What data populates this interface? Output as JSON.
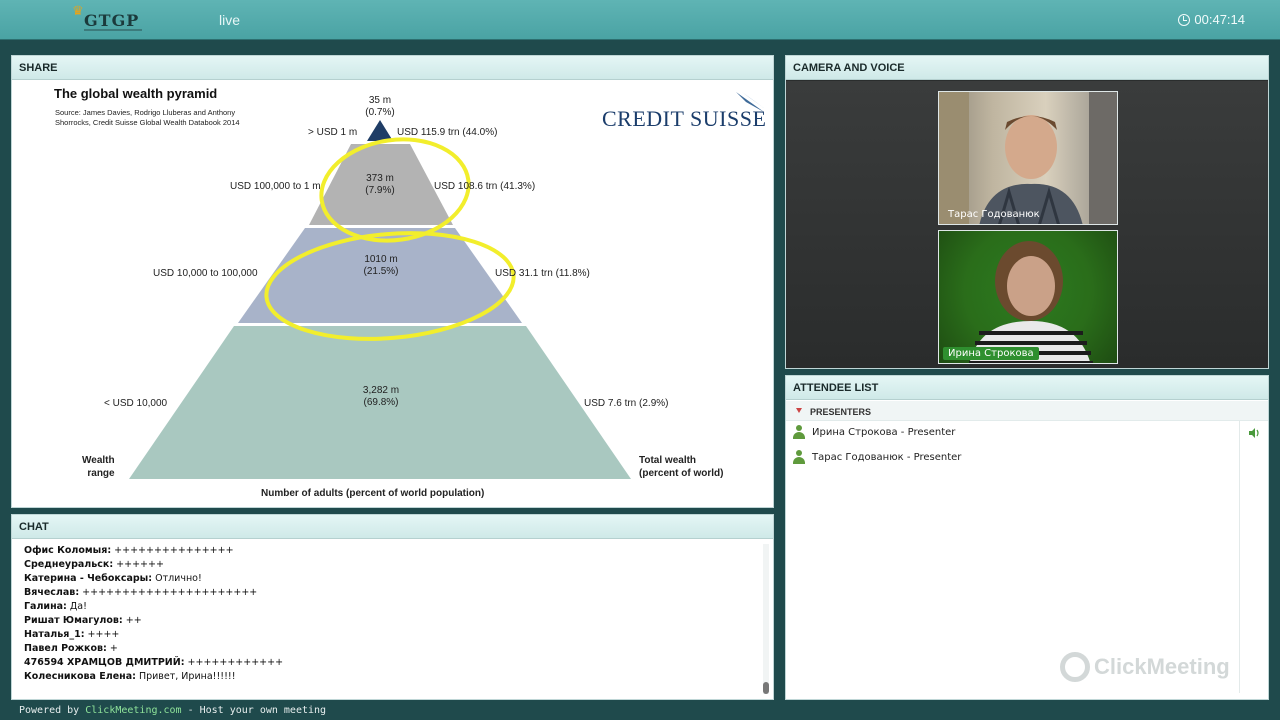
{
  "topbar": {
    "logo_text": "GTGP",
    "status": "live",
    "timer": "00:47:14"
  },
  "share": {
    "header": "SHARE",
    "slide": {
      "title": "The global wealth pyramid",
      "source": "Source: James Davies, Rodrigo Lluberas and Anthony Shorrocks, Credit Suisse Global Wealth Databook 2014",
      "brand": "CREDIT SUISSE",
      "tiers": [
        {
          "adults": "35 m",
          "pct": "(0.7%)",
          "range": "> USD 1 m",
          "wealth": "USD 115.9 trn (44.0%)"
        },
        {
          "adults": "373 m",
          "pct": "(7.9%)",
          "range": "USD 100,000 to 1 m",
          "wealth": "USD 108.6 trn (41.3%)"
        },
        {
          "adults": "1010 m",
          "pct": "(21.5%)",
          "range": "USD 10,000 to 100,000",
          "wealth": "USD 31.1 trn (11.8%)"
        },
        {
          "adults": "3,282 m",
          "pct": "(69.8%)",
          "range": "< USD 10,000",
          "wealth": "USD 7.6 trn (2.9%)"
        }
      ],
      "left_axis_line1": "Wealth",
      "left_axis_line2": "range",
      "right_axis_line1": "Total wealth",
      "right_axis_line2": "(percent of world)",
      "bottom_axis": "Number of adults (percent of world population)"
    }
  },
  "camera": {
    "header": "CAMERA AND VOICE",
    "videos": [
      {
        "name": "Тарас Годованюк",
        "label_color": "#00000000"
      },
      {
        "name": "Ирина Строкова",
        "label_color": "#2f8f2f"
      }
    ]
  },
  "attendee": {
    "header": "ATTENDEE LIST",
    "group": "PRESENTERS",
    "rows": [
      {
        "text": "Ирина Строкова - Presenter"
      },
      {
        "text": "Тарас Годованюк - Presenter"
      }
    ],
    "watermark": "ClickMeeting"
  },
  "chat": {
    "header": "CHAT",
    "messages": [
      {
        "author": "Офис Коломыя:",
        "text": " +++++++++++++++"
      },
      {
        "author": "Среднеуральск:",
        "text": " ++++++"
      },
      {
        "author": "Катерина - Чебоксары:",
        "text": " Отлично!"
      },
      {
        "author": "Вячеслав:",
        "text": " ++++++++++++++++++++++"
      },
      {
        "author": "Галина:",
        "text": " Да!"
      },
      {
        "author": "Ришат Юмагулов:",
        "text": " ++"
      },
      {
        "author": "Наталья_1:",
        "text": " ++++"
      },
      {
        "author": "Павел Рожков:",
        "text": " +"
      },
      {
        "author": "476594 ХРАМЦОВ ДМИТРИЙ:",
        "text": " ++++++++++++"
      },
      {
        "author": "Колесникова Елена:",
        "text": " Привет, Ирина!!!!!!"
      }
    ]
  },
  "footer": {
    "prefix": "Powered by ",
    "link": "ClickMeeting.com",
    "suffix": " - Host your own meeting"
  },
  "colors": {
    "topbar": "#4aa3a4",
    "tier_top": "#1f3d66",
    "tier_2": "#b3b3b3",
    "tier_3": "#a8b3c9",
    "tier_4": "#a9c8c0",
    "highlight": "#f2ee2c"
  }
}
